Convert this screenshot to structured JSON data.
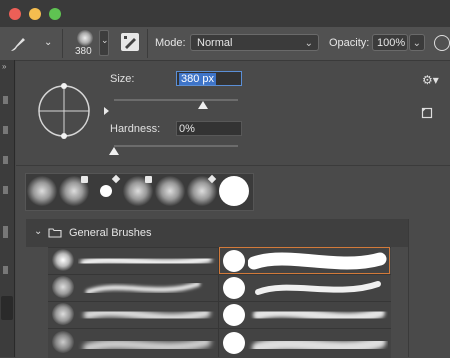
{
  "toolbar": {
    "brush_size": "380",
    "mode_label": "Mode:",
    "mode_value": "Normal",
    "opacity_label": "Opacity:",
    "opacity_value": "100%"
  },
  "brush_panel": {
    "size_label": "Size:",
    "size_value": "380 px",
    "size_fraction": 0.72,
    "hardness_label": "Hardness:",
    "hardness_value": "0%",
    "hardness_fraction": 0.0
  },
  "presets": [
    {
      "type": "soft"
    },
    {
      "type": "soft-user"
    },
    {
      "type": "hard-small-pencil"
    },
    {
      "type": "soft-user"
    },
    {
      "type": "soft"
    },
    {
      "type": "soft-pencil"
    },
    {
      "type": "hard"
    }
  ],
  "group": {
    "name": "General Brushes"
  },
  "colors": {
    "accent": "#3e74c8",
    "selection": "#d27a3a",
    "close": "#ec5f57",
    "minimize": "#f4bd4f",
    "maximize": "#5fc352"
  }
}
